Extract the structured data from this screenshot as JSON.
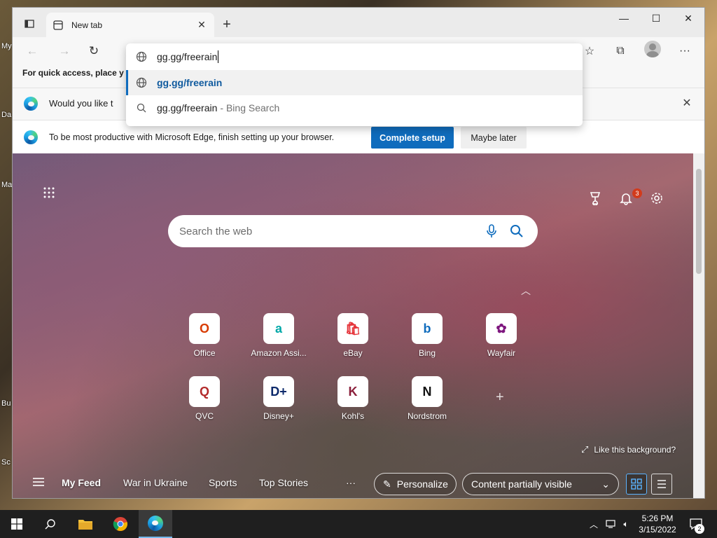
{
  "desktop": {
    "labels": [
      "My",
      "Da",
      "Ma",
      "Bu",
      "Sc"
    ]
  },
  "browser": {
    "tab": {
      "title": "New tab",
      "close_label": "✕"
    },
    "new_tab_label": "+",
    "window_controls": {
      "minimize": "—",
      "maximize": "☐",
      "close": "✕"
    },
    "favorites_bar_text": "For quick access, place y",
    "omnibox": {
      "value": "gg.gg/freerain",
      "suggestions": [
        {
          "text": "gg.gg/freerain",
          "hint": ""
        },
        {
          "text": "gg.gg/freerain",
          "hint": "- Bing Search"
        }
      ]
    },
    "infobar_default": {
      "text": "Would you like t"
    },
    "infobar_setup": {
      "text": "To be most productive with Microsoft Edge, finish setting up your browser.",
      "primary_label": "Complete setup",
      "secondary_label": "Maybe later"
    }
  },
  "ntp": {
    "search_placeholder": "Search the web",
    "notification_count": "3",
    "tiles": [
      {
        "label": "Office",
        "letter": "O",
        "color": "#d83b01"
      },
      {
        "label": "Amazon Assi...",
        "letter": "a",
        "color": "#00a8a8"
      },
      {
        "label": "eBay",
        "letter": "🛍",
        "color": "#e53238"
      },
      {
        "label": "Bing",
        "letter": "b",
        "color": "#0f6cbd"
      },
      {
        "label": "Wayfair",
        "letter": "✿",
        "color": "#7f187f"
      },
      {
        "label": "QVC",
        "letter": "Q",
        "color": "#b32b2b"
      },
      {
        "label": "Disney+",
        "letter": "D+",
        "color": "#0d2a6b"
      },
      {
        "label": "Kohl's",
        "letter": "K",
        "color": "#8a1f3b"
      },
      {
        "label": "Nordstrom",
        "letter": "N",
        "color": "#111111"
      }
    ],
    "like_background": "Like this background?",
    "feed": {
      "links": [
        "My Feed",
        "War in Ukraine",
        "Sports",
        "Top Stories"
      ],
      "more": "···",
      "personalize": "Personalize",
      "content_visibility": "Content partially visible"
    }
  },
  "taskbar": {
    "time": "5:26 PM",
    "date": "3/15/2022",
    "notification_count": "2"
  }
}
